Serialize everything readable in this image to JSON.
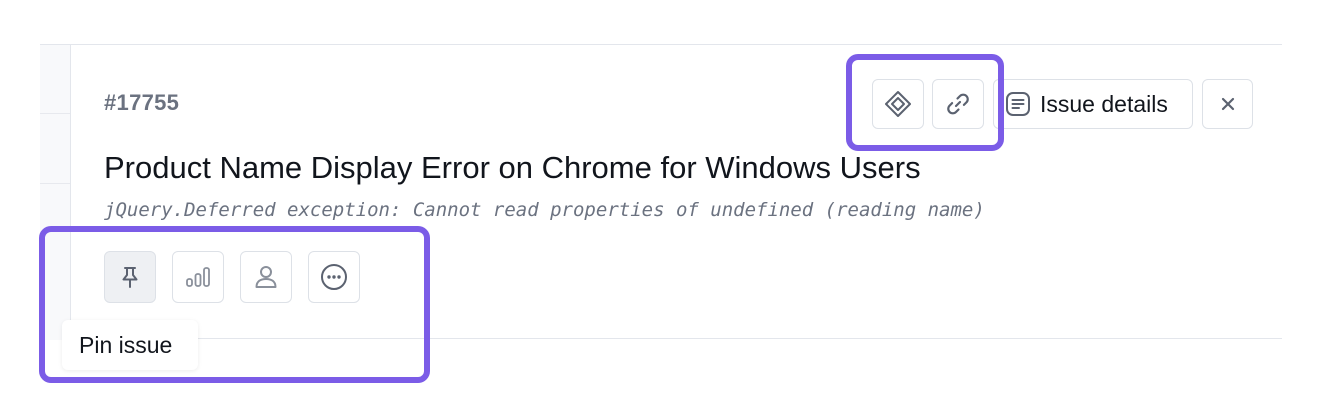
{
  "issue": {
    "id": "#17755",
    "title": "Product Name Display Error on Chrome for Windows Users",
    "error_message": "jQuery.Deferred exception: Cannot read properties of undefined (reading name)"
  },
  "header_actions": {
    "jira_icon": "diamond-icon",
    "link_icon": "link-icon",
    "details_label": "Issue details",
    "details_icon": "list-icon",
    "close_icon": "close-icon"
  },
  "action_bar": {
    "pin_icon": "pin-icon",
    "chart_icon": "bar-chart-icon",
    "assign_icon": "user-icon",
    "more_icon": "more-icon"
  },
  "tooltip": {
    "text": "Pin issue"
  },
  "colors": {
    "highlight": "#7b5ce7",
    "border": "#dde1e7",
    "text_primary": "#11151c",
    "text_muted": "#6b7280"
  }
}
